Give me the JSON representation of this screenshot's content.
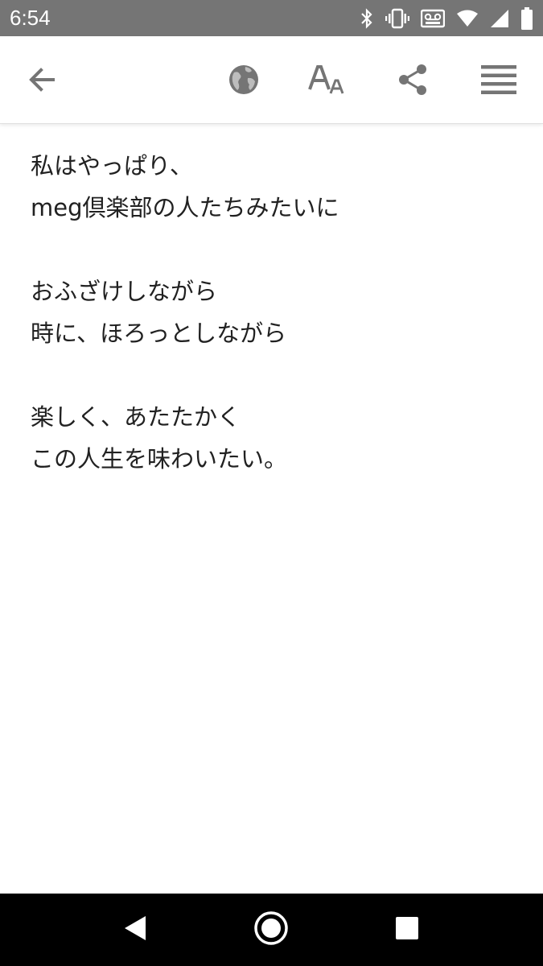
{
  "status_bar": {
    "time": "6:54",
    "icons": [
      "bluetooth-icon",
      "vibrate-icon",
      "voicemail-icon",
      "wifi-icon",
      "signal-icon",
      "battery-icon"
    ]
  },
  "toolbar": {
    "icons": [
      "back-arrow-icon",
      "globe-icon",
      "text-size-icon",
      "share-icon",
      "menu-icon"
    ],
    "icon_color": "#757575"
  },
  "article": {
    "paragraphs": [
      [
        "私はやっぱり、",
        "meg倶楽部の人たちみたいに"
      ],
      [
        "おふざけしながら",
        "時に、ほろっとしながら"
      ],
      [
        "楽しく、あたたかく",
        "この人生を味わいたい。"
      ]
    ]
  },
  "nav_bar": {
    "icons": [
      "back-triangle-icon",
      "home-circle-icon",
      "recents-square-icon"
    ]
  }
}
